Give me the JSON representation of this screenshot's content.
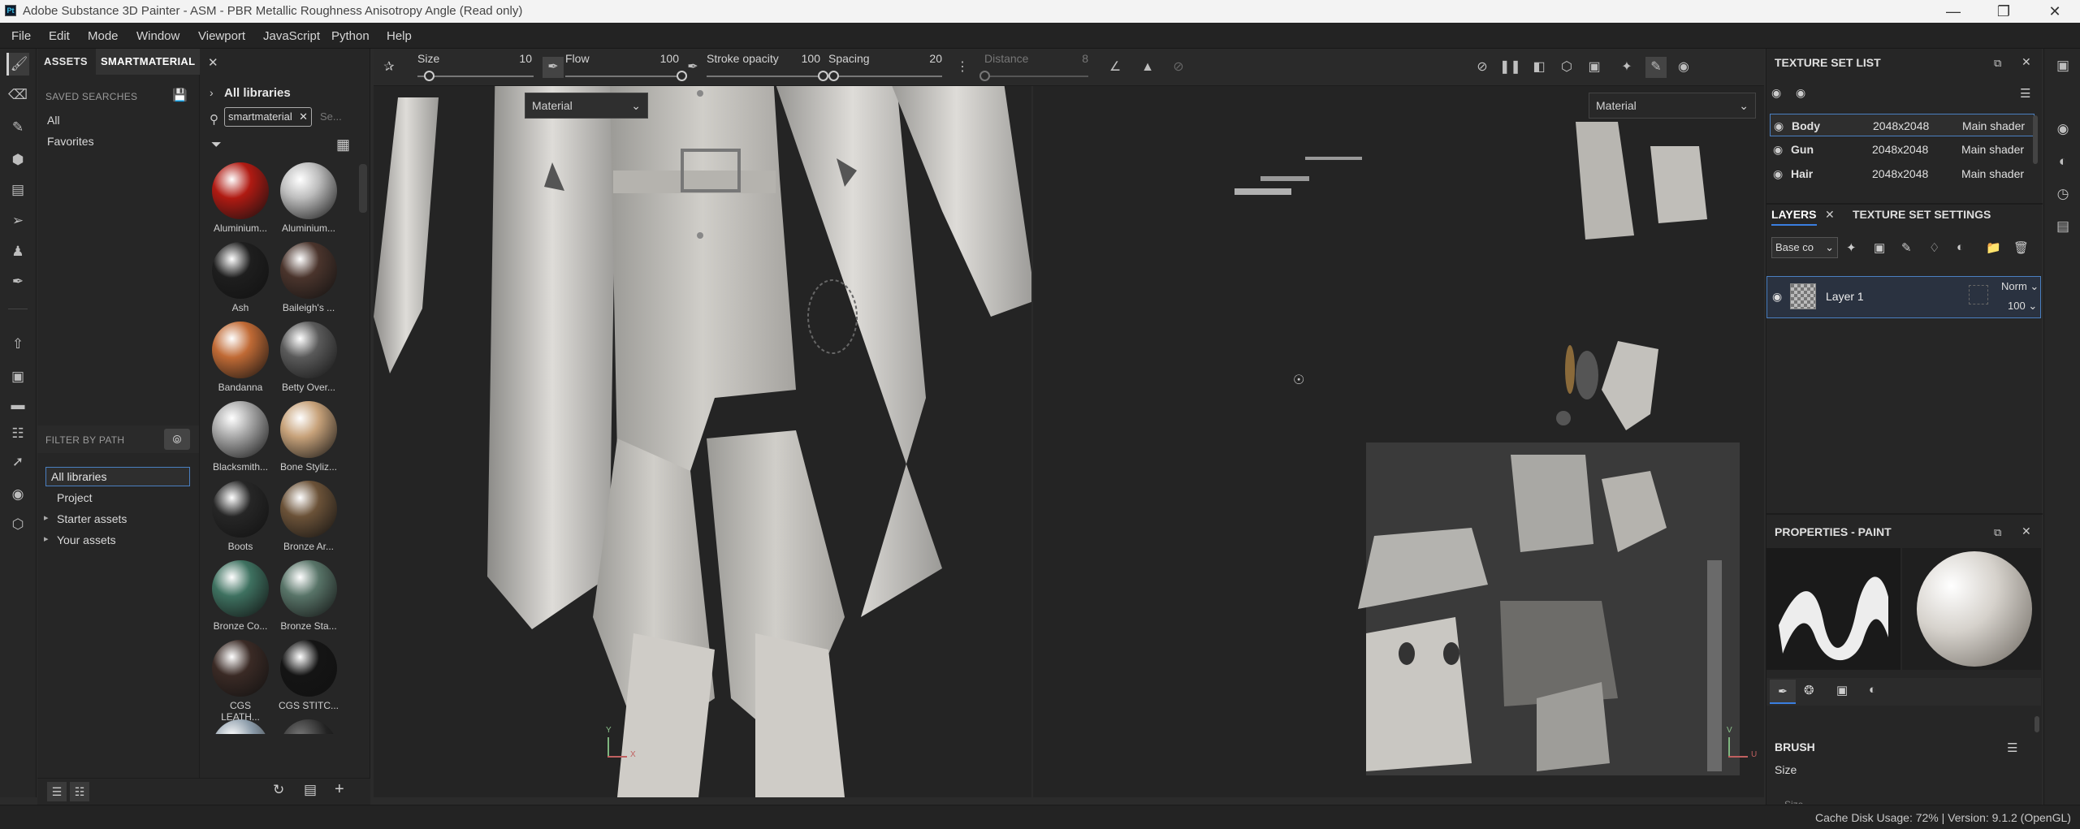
{
  "window": {
    "title": "Adobe Substance 3D Painter - ASM - PBR Metallic Roughness Anisotropy Angle (Read only)",
    "controls": [
      "minimize-icon",
      "maximize-icon",
      "close-icon"
    ]
  },
  "menu": [
    "File",
    "Edit",
    "Mode",
    "Window",
    "Viewport",
    "JavaScript",
    "Python",
    "Help"
  ],
  "assets": {
    "tab_assets": "ASSETS",
    "tab_smart": "SMARTMATERIAL",
    "saved_searches_label": "SAVED SEARCHES",
    "saved": [
      "All",
      "Favorites"
    ],
    "breadcrumb": "All libraries",
    "search_chip": "smartmaterial",
    "search_placeholder": "Se...",
    "filter_by_path_label": "FILTER BY PATH",
    "paths": [
      "All libraries",
      "Project",
      "Starter assets",
      "Your assets"
    ],
    "materials": [
      {
        "name": "Aluminium...",
        "color": "#b01a12"
      },
      {
        "name": "Aluminium...",
        "color": "#bdbdbd"
      },
      {
        "name": "Ash",
        "color": "#1e1e1e"
      },
      {
        "name": "Baileigh's ...",
        "color": "#4a342c"
      },
      {
        "name": "Bandanna",
        "color": "#c06a35"
      },
      {
        "name": "Betty Over...",
        "color": "#5a5a5a"
      },
      {
        "name": "Blacksmith...",
        "color": "#a9a9a9"
      },
      {
        "name": "Bone Styliz...",
        "color": "#c7a27a"
      },
      {
        "name": "Boots",
        "color": "#262626"
      },
      {
        "name": "Bronze Ar...",
        "color": "#6b5238"
      },
      {
        "name": "Bronze Co...",
        "color": "#3e7160"
      },
      {
        "name": "Bronze Sta...",
        "color": "#587468"
      },
      {
        "name": "CGS LEATH...",
        "color": "#3a2a25"
      },
      {
        "name": "CGS STITC...",
        "color": "#141414"
      }
    ]
  },
  "toolbar": {
    "size_label": "Size",
    "size_value": "10",
    "size_fraction": 0.1,
    "flow_label": "Flow",
    "flow_value": "100",
    "flow_fraction": 1.0,
    "opacity_label": "Stroke opacity",
    "opacity_value": "100",
    "opacity_fraction": 1.0,
    "spacing_label": "Spacing",
    "spacing_value": "20",
    "spacing_fraction": 0.0,
    "distance_label": "Distance",
    "distance_value": "8",
    "distance_fraction": 0.0
  },
  "viewport3d": {
    "mode_label": "Material",
    "axis_x": "X",
    "axis_y": "Y"
  },
  "viewport2d": {
    "mode_label": "Material",
    "axis_u": "U",
    "axis_v": "V"
  },
  "texture_set_list": {
    "title": "TEXTURE SET LIST",
    "rows": [
      {
        "name": "Body",
        "size": "2048x2048",
        "shader": "Main shader"
      },
      {
        "name": "Gun",
        "size": "2048x2048",
        "shader": "Main shader"
      },
      {
        "name": "Hair",
        "size": "2048x2048",
        "shader": "Main shader"
      }
    ]
  },
  "layers": {
    "tab_layers": "LAYERS",
    "tab_settings": "TEXTURE SET SETTINGS",
    "channel": "Base co",
    "layer_name": "Layer 1",
    "blend_mode": "Norm",
    "opacity": "100"
  },
  "properties": {
    "title": "PROPERTIES - PAINT",
    "brush_label": "BRUSH",
    "size_label": "Size",
    "size_sub": "Size"
  },
  "status": {
    "cache": "Cache Disk Usage:",
    "cache_value": "72%",
    "version": "| Version: 9.1.2 (OpenGL)"
  }
}
